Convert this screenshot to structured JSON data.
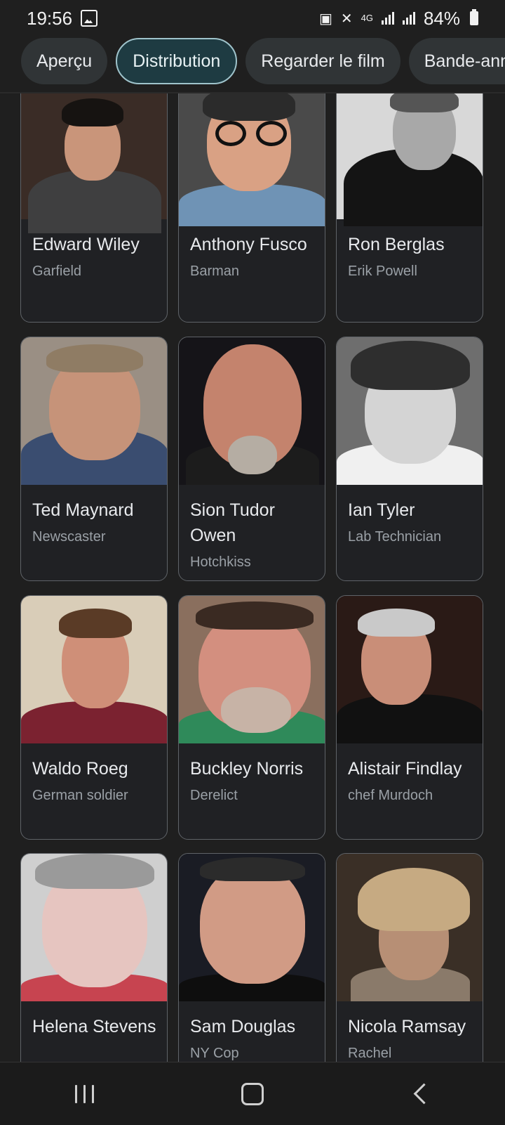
{
  "status_bar": {
    "time": "19:56",
    "network": "4G",
    "battery": "84%"
  },
  "chips": [
    "Aperçu",
    "Distribution",
    "Regarder le film",
    "Bande-annonce"
  ],
  "active_chip": "Distribution",
  "cast": [
    {
      "name": "Edward Wiley",
      "role": "Garfield"
    },
    {
      "name": "Anthony Fusco",
      "role": "Barman"
    },
    {
      "name": "Ron Berglas",
      "role": "Erik Powell"
    },
    {
      "name": "Ted Maynard",
      "role": "Newscaster"
    },
    {
      "name": "Sion Tudor Owen",
      "role": "Hotchkiss"
    },
    {
      "name": "Ian Tyler",
      "role": "Lab Technician"
    },
    {
      "name": "Waldo Roeg",
      "role": "German soldier"
    },
    {
      "name": "Buckley Norris",
      "role": "Derelict"
    },
    {
      "name": "Alistair Findlay",
      "role": "chef Murdoch"
    },
    {
      "name": "Helena Stevens",
      "role": ""
    },
    {
      "name": "Sam Douglas",
      "role": "NY Cop"
    },
    {
      "name": "Nicola Ramsay",
      "role": "Rachel"
    }
  ],
  "nav": {
    "recent_icon": "recent-apps-icon",
    "home_icon": "home-icon",
    "back_icon": "back-icon"
  }
}
